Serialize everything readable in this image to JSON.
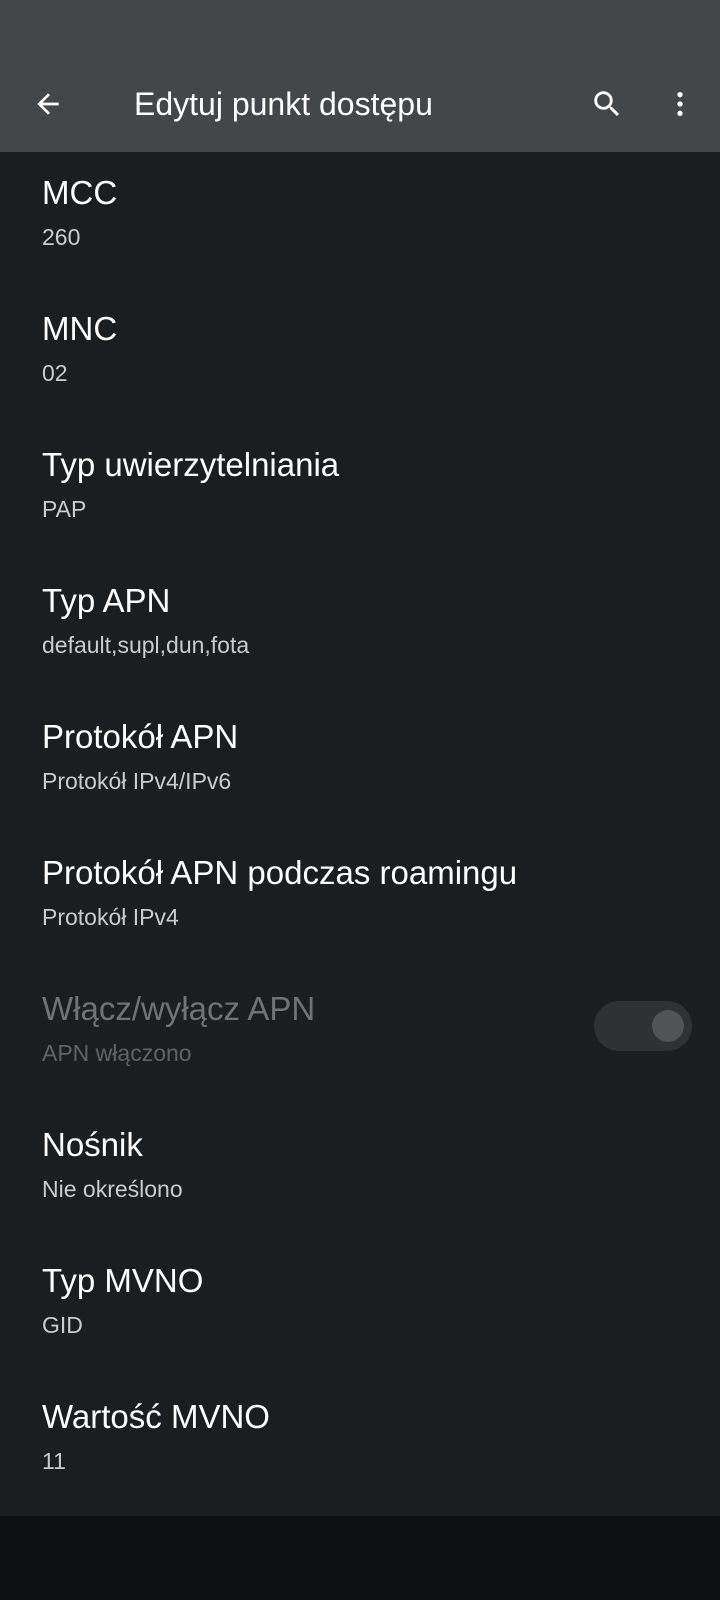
{
  "app_bar": {
    "title": "Edytuj punkt dostępu",
    "back_icon": "arrow-back-icon",
    "search_icon": "search-icon",
    "more_icon": "more-vert-icon"
  },
  "prefs": [
    {
      "title": "MCC",
      "summary": "260"
    },
    {
      "title": "MNC",
      "summary": "02"
    },
    {
      "title": "Typ uwierzytelniania",
      "summary": "PAP"
    },
    {
      "title": "Typ APN",
      "summary": "default,supl,dun,fota"
    },
    {
      "title": "Protokół APN",
      "summary": "Protokół IPv4/IPv6"
    },
    {
      "title": "Protokół APN podczas roamingu",
      "summary": "Protokół IPv4"
    },
    {
      "title": "Włącz/wyłącz APN",
      "summary": "APN włączono",
      "enabled": false,
      "toggle_on": true
    },
    {
      "title": "Nośnik",
      "summary": "Nie określono"
    },
    {
      "title": "Typ MVNO",
      "summary": "GID"
    },
    {
      "title": "Wartość MVNO",
      "summary": "11"
    }
  ],
  "colors": {
    "app_bar_bg": "#44474a",
    "background": "#1b1e20",
    "nav_bar_bg": "#0f1012",
    "text_primary": "#ffffff",
    "text_secondary": "#c9cbcd"
  }
}
